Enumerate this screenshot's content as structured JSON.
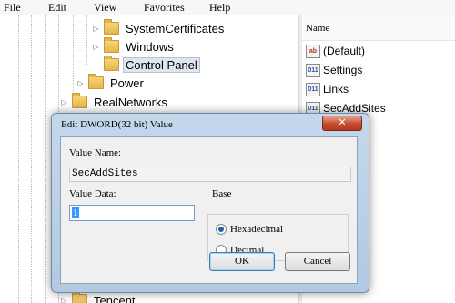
{
  "menu": [
    "File",
    "Edit",
    "View",
    "Favorites",
    "Help"
  ],
  "tree": {
    "nodes": [
      {
        "label": "SystemCertificates",
        "expander": "collapsed",
        "selected": false
      },
      {
        "label": "Windows",
        "expander": "collapsed",
        "selected": false
      },
      {
        "label": "Control Panel",
        "expander": "none",
        "selected": true
      },
      {
        "label": "Power",
        "expander": "collapsed",
        "selected": false
      },
      {
        "label": "RealNetworks",
        "expander": "collapsed",
        "selected": false
      },
      {
        "label": "Tencent",
        "expander": "collapsed",
        "selected": false
      }
    ]
  },
  "list": {
    "column_header": "Name",
    "items": [
      {
        "name": "(Default)",
        "icon": "string-value-icon",
        "icon_text": "ab"
      },
      {
        "name": "Settings",
        "icon": "binary-value-icon",
        "icon_text": "011"
      },
      {
        "name": "Links",
        "icon": "binary-value-icon",
        "icon_text": "011"
      },
      {
        "name": "SecAddSites",
        "icon": "binary-value-icon",
        "icon_text": "011"
      }
    ]
  },
  "dialog": {
    "title": "Edit DWORD(32 bit) Value",
    "close_label": "✕",
    "value_name_label": "Value Name:",
    "value_name": "SecAddSites",
    "value_data_label": "Value Data:",
    "value_data": "1",
    "base_label": "Base",
    "base_options": [
      {
        "label": "Hexadecimal",
        "selected": true
      },
      {
        "label": "Decimal",
        "selected": false
      }
    ],
    "ok_label": "OK",
    "cancel_label": "Cancel"
  },
  "colors": {
    "dialog_frame": "#b2c9e1",
    "close_button": "#c44a2e",
    "selection": "#3399ff"
  }
}
